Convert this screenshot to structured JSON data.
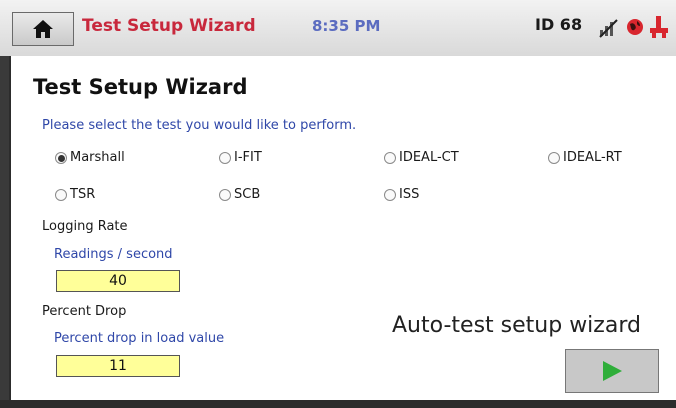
{
  "header": {
    "title": "Test Setup Wizard",
    "time": "8:35 PM",
    "id_label": "ID 68",
    "icons": [
      "home-icon",
      "no-signal-icon",
      "globe-icon",
      "connector-icon"
    ]
  },
  "main": {
    "heading": "Test Setup Wizard",
    "prompt": "Please select the test you would like to perform.",
    "tests": [
      {
        "label": "Marshall",
        "selected": true
      },
      {
        "label": "I-FIT",
        "selected": false
      },
      {
        "label": "IDEAL-CT",
        "selected": false
      },
      {
        "label": "IDEAL-RT",
        "selected": false
      },
      {
        "label": "TSR",
        "selected": false
      },
      {
        "label": "SCB",
        "selected": false
      },
      {
        "label": "ISS",
        "selected": false
      }
    ],
    "logging": {
      "label": "Logging Rate",
      "sub_label": "Readings / second",
      "value": "40"
    },
    "percent_drop": {
      "label": "Percent Drop",
      "sub_label": "Percent drop in load value",
      "value": "11"
    },
    "wizard_caption": "Auto-test setup wizard"
  },
  "colors": {
    "title": "#c8283c",
    "time": "#5b6cc0",
    "link_text": "#2f47a8",
    "value_box": "#ffff99",
    "play": "#2fae3a"
  }
}
